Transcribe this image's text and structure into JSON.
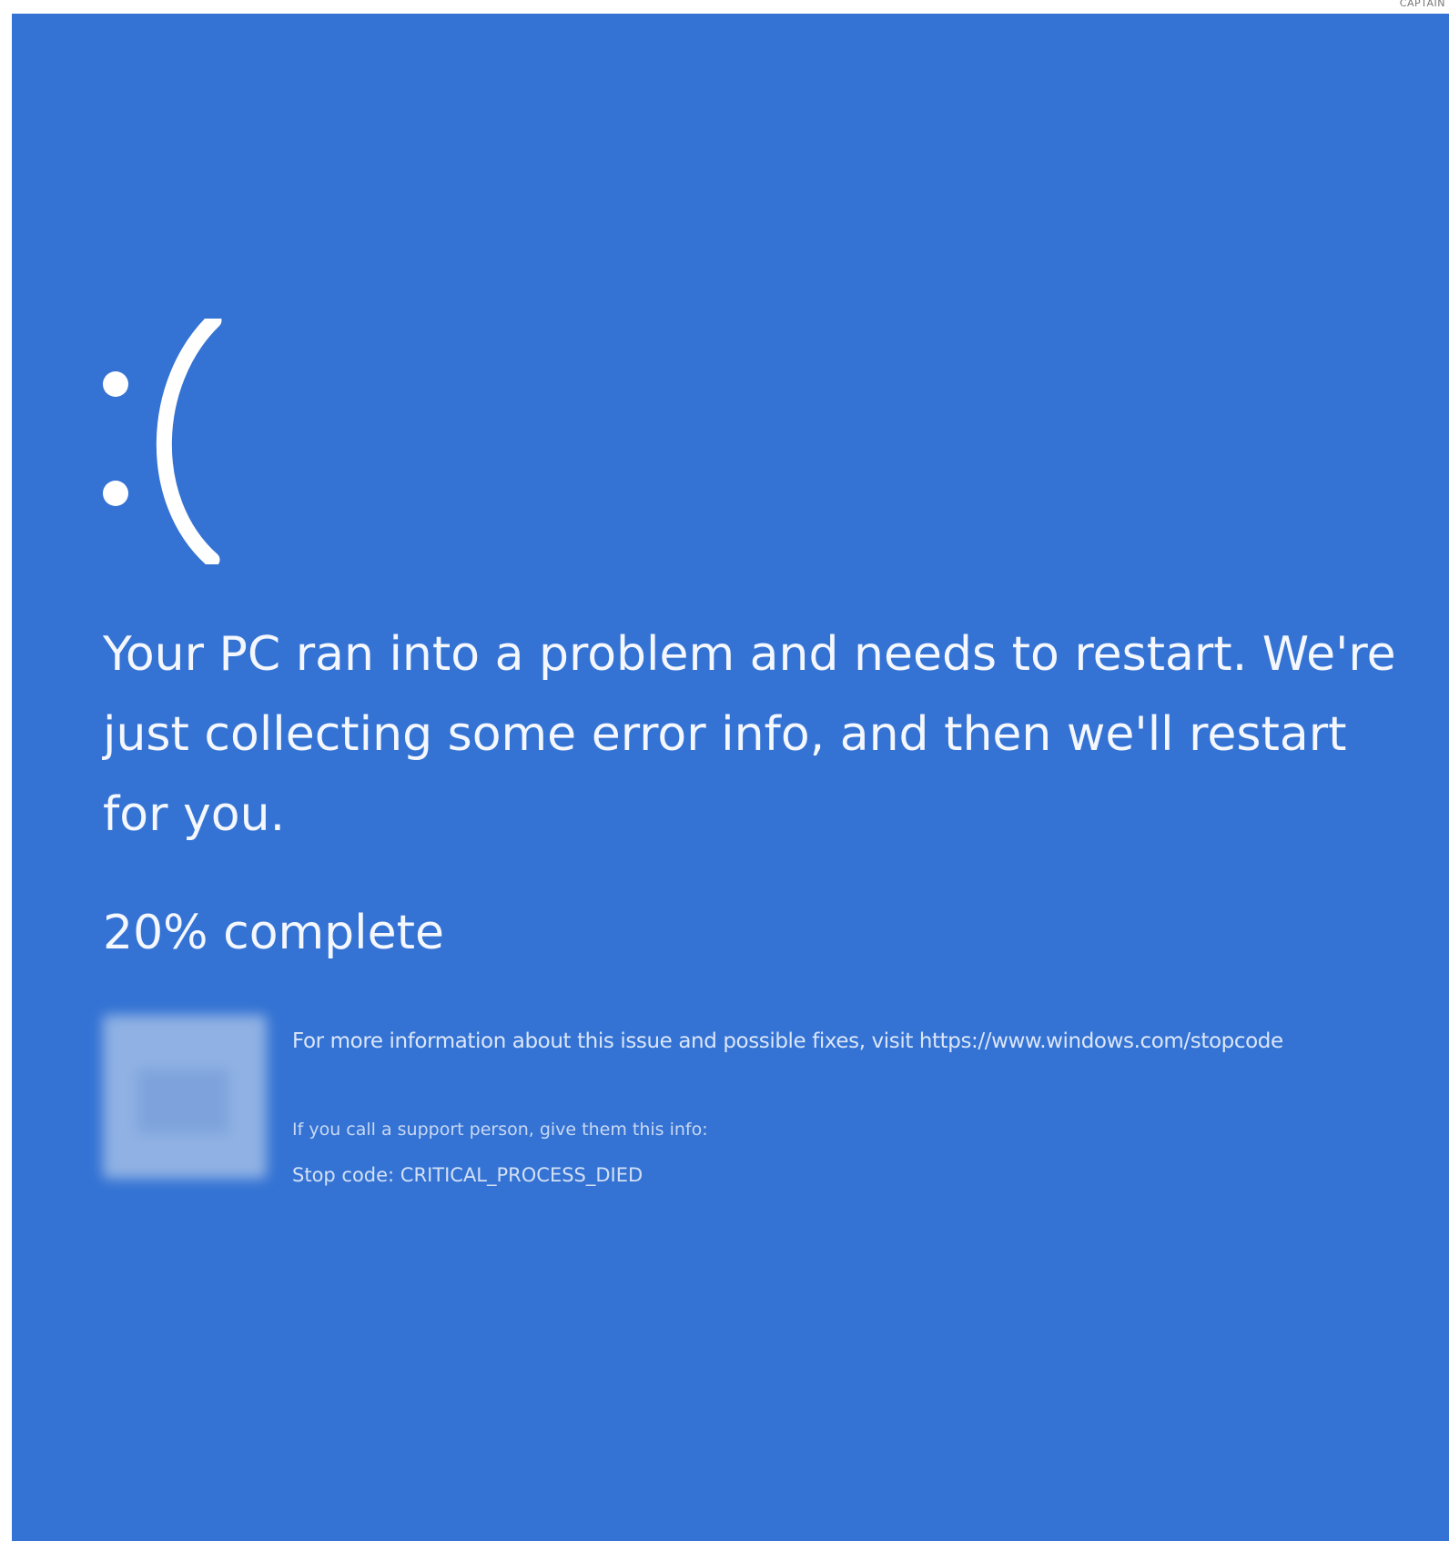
{
  "corner_credit": "CAPTAIN",
  "colors": {
    "background": "#3473d4",
    "text": "#f4f7fd"
  },
  "face": {
    "icon": "sad-face-icon",
    "text": ":("
  },
  "message": "Your PC ran into a problem and needs to restart. We're just collecting some error info, and then we'll restart for you.",
  "progress": {
    "percent": 20,
    "label": "20% complete"
  },
  "qr_code": {
    "icon": "qr-code-icon"
  },
  "more_info": "For more information about this issue and possible fixes, visit https://www.windows.com/stopcode",
  "support_text": "If you call a support person, give them this info:",
  "stop_code": "Stop code: CRITICAL_PROCESS_DIED"
}
